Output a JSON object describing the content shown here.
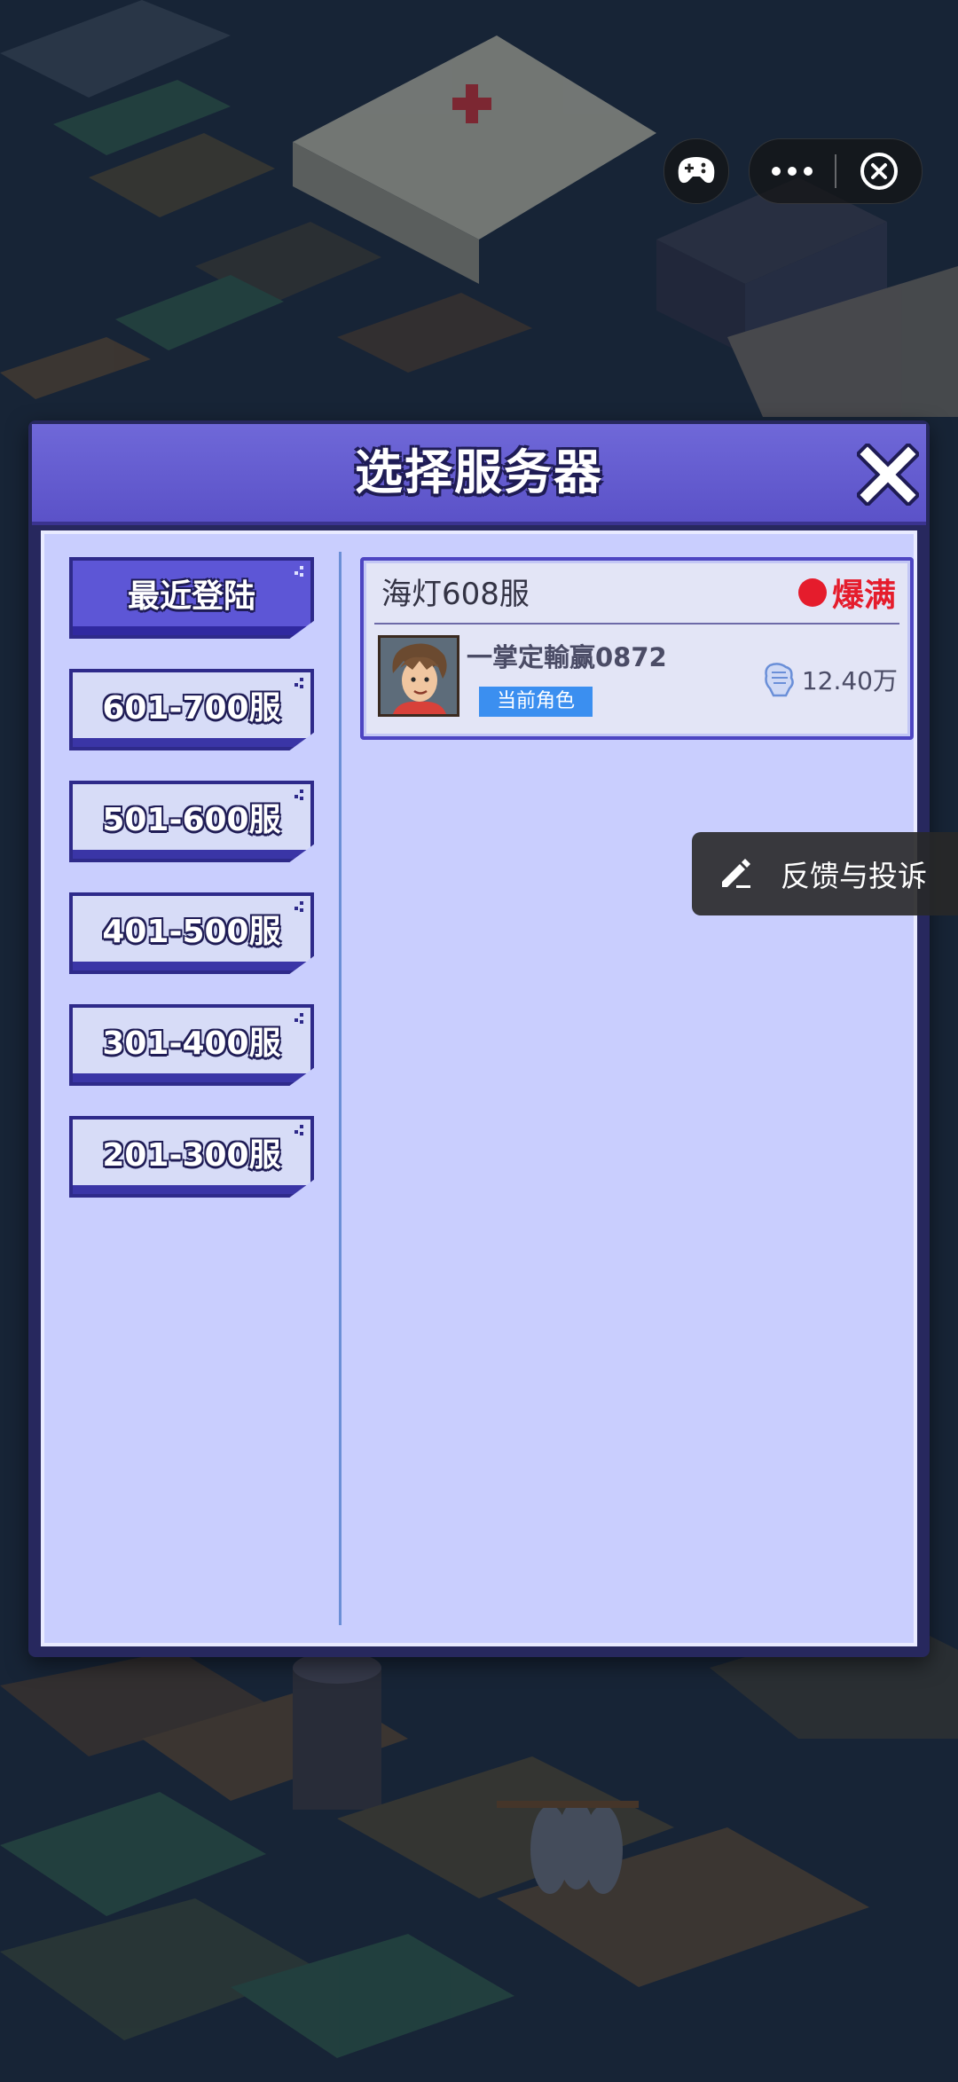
{
  "dialog": {
    "title": "选择服务器"
  },
  "tabs": [
    {
      "label": "最近登陆",
      "active": true
    },
    {
      "label": "601-700服",
      "active": false
    },
    {
      "label": "501-600服",
      "active": false
    },
    {
      "label": "401-500服",
      "active": false
    },
    {
      "label": "301-400服",
      "active": false
    },
    {
      "label": "201-300服",
      "active": false
    }
  ],
  "server": {
    "name": "海灯608服",
    "status": "爆满",
    "status_color": "#e51c2c",
    "character_name": "一掌定輸赢0872",
    "role_badge": "当前角色",
    "power": "12.40万",
    "power_icon": "fist-icon"
  },
  "feedback": {
    "label": "反馈与投诉",
    "icon": "pencil-icon"
  },
  "capsule": {
    "game_icon": "gamepad-icon",
    "more_icon": "more-dots-icon",
    "close_icon": "close-circle-icon"
  },
  "colors": {
    "accent": "#5d56d6",
    "panel": "#c9cefe",
    "header": "#6f68d8"
  }
}
